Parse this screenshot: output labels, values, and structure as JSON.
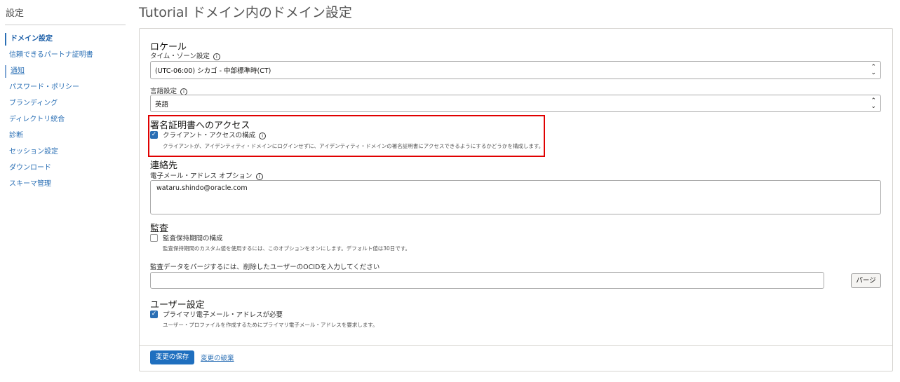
{
  "sidebar": {
    "title": "設定",
    "items": [
      {
        "label": "ドメイン設定",
        "state": "active"
      },
      {
        "label": "信頼できるパートナ証明書"
      },
      {
        "label": "通知",
        "state": "marked"
      },
      {
        "label": "パスワード・ポリシー"
      },
      {
        "label": "ブランディング"
      },
      {
        "label": "ディレクトリ統合"
      },
      {
        "label": "診断"
      },
      {
        "label": "セッション設定"
      },
      {
        "label": "ダウンロード"
      },
      {
        "label": "スキーマ管理"
      }
    ]
  },
  "header": {
    "title": "Tutorial ドメイン内のドメイン設定"
  },
  "locale": {
    "title": "ロケール",
    "timezone_label": "タイム・ゾーン設定",
    "timezone_value": "(UTC-06:00) シカゴ - 中部標準時(CT)",
    "language_label": "言語設定",
    "language_value": "英語"
  },
  "signing": {
    "title": "署名証明書へのアクセス",
    "checkbox_label": "クライアント・アクセスの構成",
    "checked": true,
    "description": "クライアントが、アイデンティティ・ドメインにログインせずに、アイデンティティ・ドメインの署名証明書にアクセスできるようにするかどうかを構成します。",
    "highlight_color": "#e00000"
  },
  "contact": {
    "title": "連絡先",
    "email_label": "電子メール・アドレス オプション",
    "email_value": "wataru.shindo@oracle.com"
  },
  "audit": {
    "title": "監査",
    "checkbox_label": "監査保持期間の構成",
    "checked": false,
    "description": "監査保持期間のカスタム値を使用するには、このオプションをオンにします。デフォルト値は30日です。",
    "purge_label": "監査データをパージするには、削除したユーザーのOCIDを入力してください",
    "purge_value": "",
    "purge_button": "パージ"
  },
  "user": {
    "title": "ユーザー設定",
    "checkbox_label": "プライマリ電子メール・アドレスが必要",
    "checked": true,
    "description": "ユーザー・プロファイルを作成するためにプライマリ電子メール・アドレスを要求します。"
  },
  "footer": {
    "save": "変更の保存",
    "discard": "変更の破棄"
  },
  "colors": {
    "accent": "#1f6fbf"
  },
  "icons": {
    "info": "i",
    "check": "✓",
    "chevron": "⌃⌄"
  }
}
